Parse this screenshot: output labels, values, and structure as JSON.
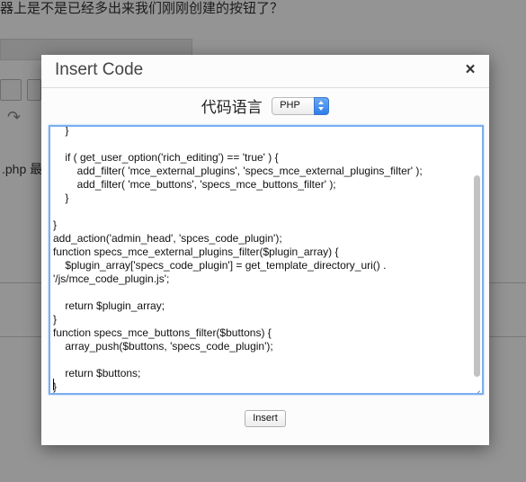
{
  "background": {
    "heading": "器上是不是已经多出来我们刚刚创建的按钮了？",
    "text_fragment": ".php 最"
  },
  "dialog": {
    "title": "Insert Code",
    "close_symbol": "×",
    "language_label": "代码语言",
    "language_select": {
      "value": "PHP"
    },
    "code_lines": [
      "    }",
      "",
      "    if ( get_user_option('rich_editing') == 'true' ) {",
      "        add_filter( 'mce_external_plugins', 'specs_mce_external_plugins_filter' );",
      "        add_filter( 'mce_buttons', 'specs_mce_buttons_filter' );",
      "    }",
      "",
      "}",
      "add_action('admin_head', 'spces_code_plugin');",
      "function specs_mce_external_plugins_filter($plugin_array) {",
      "    $plugin_array['specs_code_plugin'] = get_template_directory_uri() .",
      "'/js/mce_code_plugin.js';",
      "",
      "    return $plugin_array;",
      "}",
      "function specs_mce_buttons_filter($buttons) {",
      "    array_push($buttons, 'specs_code_plugin');",
      "",
      "    return $buttons;",
      "}"
    ],
    "insert_label": "Insert"
  },
  "colors": {
    "focus_border": "#7aaef0",
    "select_arrow": "#2f7de8"
  }
}
